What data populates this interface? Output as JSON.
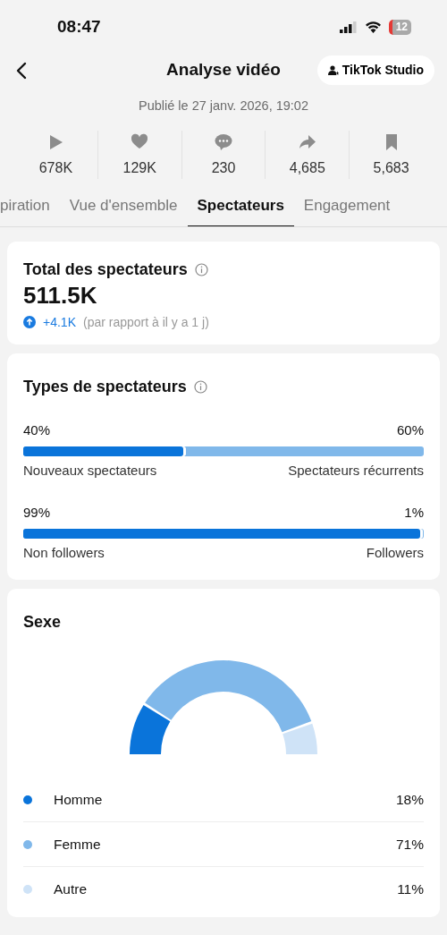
{
  "status_bar": {
    "time": "08:47",
    "battery": "12"
  },
  "header": {
    "title": "Analyse vidéo",
    "studio_button": "TikTok Studio",
    "published": "Publié le 27 janv. 2026, 19:02"
  },
  "stats": [
    {
      "kind": "play",
      "value": "678K"
    },
    {
      "kind": "like",
      "value": "129K"
    },
    {
      "kind": "comment",
      "value": "230"
    },
    {
      "kind": "share",
      "value": "4,685"
    },
    {
      "kind": "save",
      "value": "5,683"
    }
  ],
  "tabs": [
    {
      "label": "piration",
      "selected": false
    },
    {
      "label": "Vue d'ensemble",
      "selected": false
    },
    {
      "label": "Spectateurs",
      "selected": true
    },
    {
      "label": "Engagement",
      "selected": false
    }
  ],
  "total": {
    "title": "Total des spectateurs",
    "value": "511.5K",
    "change": "+4.1K",
    "change_note": "(par rapport à il y a 1 j)"
  },
  "viewer_types": {
    "title": "Types de spectateurs",
    "splits": [
      {
        "left_percent": "40%",
        "right_percent": "60%",
        "left_label": "Nouveaux spectateurs",
        "right_label": "Spectateurs récurrents",
        "level": 0.4
      },
      {
        "left_percent": "99%",
        "right_percent": "1%",
        "left_label": "Non followers",
        "right_label": "Followers",
        "level": 0.99
      }
    ]
  },
  "gender": {
    "title": "Sexe",
    "chart_data": {
      "type": "donut",
      "categories": [
        "Homme",
        "Femme",
        "Autre"
      ],
      "values": [
        18,
        71,
        11
      ]
    },
    "legend": [
      {
        "value": "18%",
        "color": "#0a74da"
      },
      {
        "value": "71%",
        "color": "#80b8ea"
      },
      {
        "value": "11%",
        "color": "#cfe3f7"
      }
    ]
  }
}
